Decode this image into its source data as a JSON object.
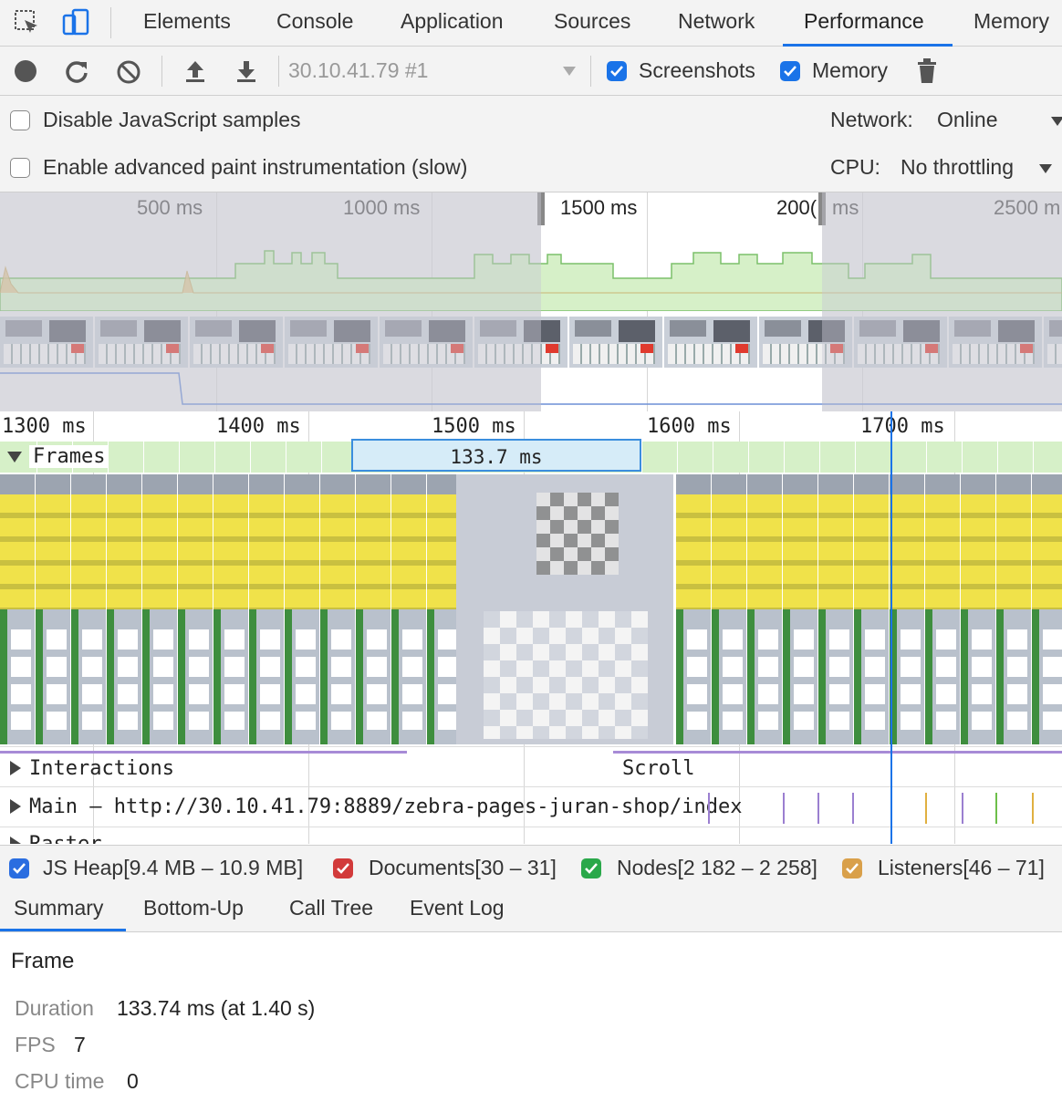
{
  "tabs": [
    "Elements",
    "Console",
    "Application",
    "Sources",
    "Network",
    "Performance",
    "Memory"
  ],
  "active_tab": "Performance",
  "toolbar": {
    "profile_select": "30.10.41.79 #1",
    "screenshots_label": "Screenshots",
    "screenshots_checked": true,
    "memory_label": "Memory",
    "memory_checked": true
  },
  "settings": {
    "disable_js_samples": "Disable JavaScript samples",
    "advanced_paint": "Enable advanced paint instrumentation (slow)",
    "network_label": "Network:",
    "network_value": "Online",
    "cpu_label": "CPU:",
    "cpu_value": "No throttling"
  },
  "overview": {
    "ruler": [
      "500 ms",
      "1000 ms",
      "1500 ms",
      "200(",
      "ms",
      "2500 m"
    ]
  },
  "flame": {
    "ticks": [
      "1300 ms",
      "1400 ms",
      "1500 ms",
      "1600 ms",
      "1700 ms"
    ],
    "frames_label": "Frames",
    "selected_frame": "133.7 ms",
    "interactions_label": "Interactions",
    "scroll_label": "Scroll",
    "main_label": "Main — http://30.10.41.79:8889/zebra-pages-juran-shop/index",
    "raster_label": "Raster"
  },
  "legend": {
    "js_heap": "JS Heap[9.4 MB – 10.9 MB]",
    "documents": "Documents[30 – 31]",
    "nodes": "Nodes[2 182 – 2 258]",
    "listeners": "Listeners[46 – 71]",
    "colors": {
      "js_heap": "#2a6de0",
      "documents": "#d23a3a",
      "nodes": "#2aa84a",
      "listeners": "#d9a04a"
    }
  },
  "bottom_tabs": [
    "Summary",
    "Bottom-Up",
    "Call Tree",
    "Event Log"
  ],
  "summary": {
    "title": "Frame",
    "duration_label": "Duration",
    "duration_value": "133.74 ms (at 1.40 s)",
    "fps_label": "FPS",
    "fps_value": "7",
    "cpu_label": "CPU time",
    "cpu_value": "0"
  }
}
